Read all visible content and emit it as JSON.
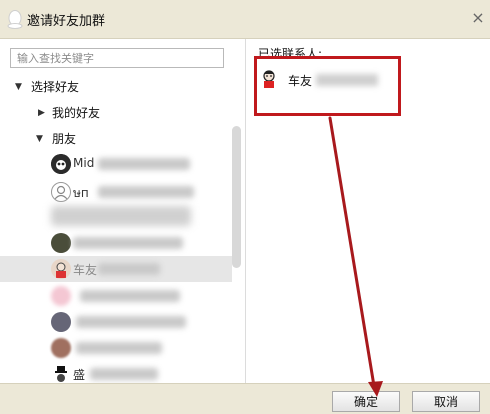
{
  "window": {
    "title": "邀请好友加群",
    "close_label": "×"
  },
  "search": {
    "placeholder": "输入查找关键字"
  },
  "tree": {
    "root_label": "选择好友",
    "groups": [
      {
        "label": "我的好友",
        "expanded": false
      },
      {
        "label": "朋友",
        "expanded": true
      }
    ],
    "friends": [
      {
        "name": "Mid"
      },
      {
        "name": "ษп"
      },
      {
        "name": ""
      },
      {
        "name": ""
      },
      {
        "name": "车友"
      },
      {
        "name": ""
      },
      {
        "name": ""
      },
      {
        "name": ""
      },
      {
        "name": "盛"
      }
    ]
  },
  "selected": {
    "heading": "已选联系人:",
    "contacts": [
      {
        "name": "车友"
      }
    ]
  },
  "footer": {
    "ok_label": "确定",
    "cancel_label": "取消"
  },
  "colors": {
    "title_bar": "#ece8d7",
    "highlight_border": "#c0191d",
    "annotation_arrow": "#a8191d"
  }
}
